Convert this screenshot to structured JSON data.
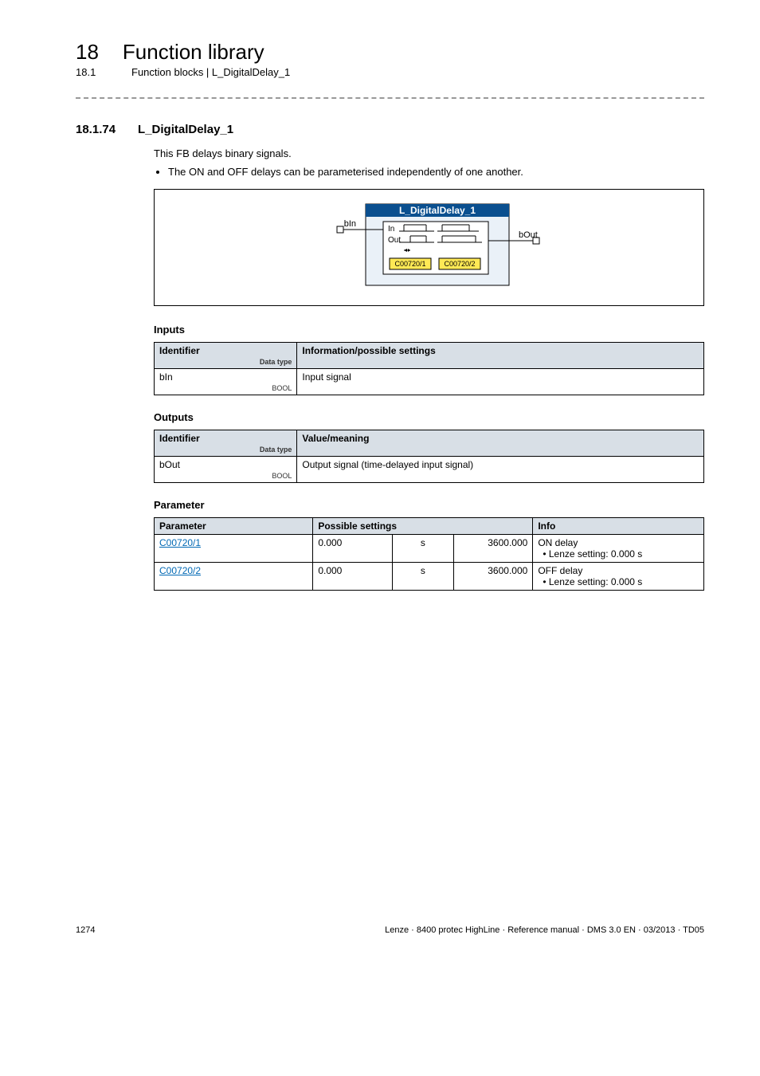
{
  "pageHeader": {
    "chapterNum": "18",
    "chapterTitle": "Function library",
    "sectionNum": "18.1",
    "sectionTitle": "Function blocks | L_DigitalDelay_1"
  },
  "section": {
    "num": "18.1.74",
    "title": "L_DigitalDelay_1",
    "lead": "This FB delays binary signals.",
    "bullet": "The ON and OFF delays can be parameterised independently of one another."
  },
  "diagram": {
    "blockTitle": "L_DigitalDelay_1",
    "inPort": "bIn",
    "outPort": "bOut",
    "innerIn": "In",
    "innerOut": "Out",
    "code1": "C00720/1",
    "code2": "C00720/2"
  },
  "inputs": {
    "heading": "Inputs",
    "col1": "Identifier",
    "col1sub": "Data type",
    "col2": "Information/possible settings",
    "rows": [
      {
        "id": "bIn",
        "dt": "BOOL",
        "info": "Input signal"
      }
    ]
  },
  "outputs": {
    "heading": "Outputs",
    "col1": "Identifier",
    "col1sub": "Data type",
    "col2": "Value/meaning",
    "rows": [
      {
        "id": "bOut",
        "dt": "BOOL",
        "info": "Output signal (time-delayed input signal)"
      }
    ]
  },
  "params": {
    "heading": "Parameter",
    "col1": "Parameter",
    "col2": "Possible settings",
    "col3": "Info",
    "rows": [
      {
        "p": "C00720/1",
        "lo": "0.000",
        "u": "s",
        "hi": "3600.000",
        "info": "ON delay",
        "sub": "• Lenze setting: 0.000 s"
      },
      {
        "p": "C00720/2",
        "lo": "0.000",
        "u": "s",
        "hi": "3600.000",
        "info": "OFF delay",
        "sub": "• Lenze setting: 0.000 s"
      }
    ]
  },
  "footer": {
    "page": "1274",
    "right": "Lenze · 8400 protec HighLine · Reference manual · DMS 3.0 EN · 03/2013 · TD05"
  }
}
